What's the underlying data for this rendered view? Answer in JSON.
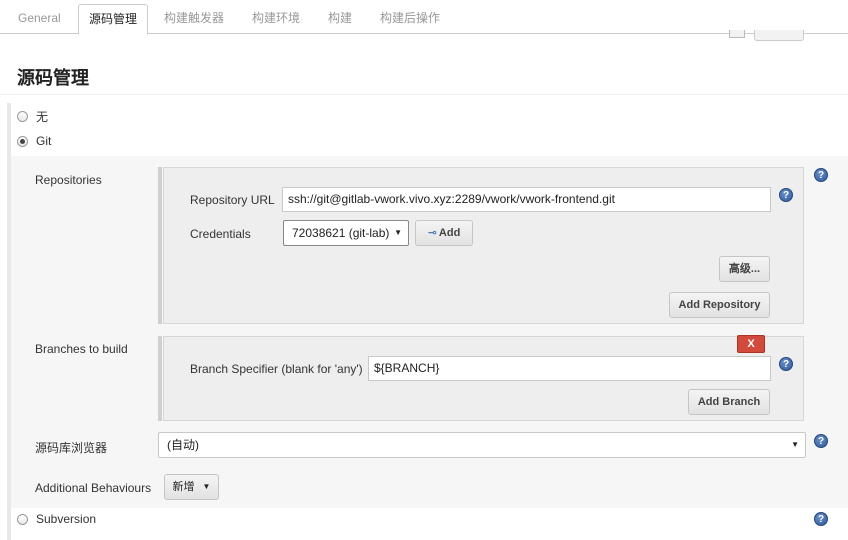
{
  "tabs": [
    {
      "label": "General",
      "active": false
    },
    {
      "label": "源码管理",
      "active": true
    },
    {
      "label": "构建触发器",
      "active": false
    },
    {
      "label": "构建环境",
      "active": false
    },
    {
      "label": "构建",
      "active": false
    },
    {
      "label": "构建后操作",
      "active": false
    }
  ],
  "section": {
    "title": "源码管理",
    "options": {
      "none": "无",
      "git": "Git",
      "subversion": "Subversion"
    },
    "selected": "Git"
  },
  "repositories": {
    "label": "Repositories",
    "url_label": "Repository URL",
    "url_value": "ssh://git@gitlab-vwork.vivo.xyz:2289/vwork/vwork-frontend.git",
    "credentials_label": "Credentials",
    "credentials_value": "72038621 (git-lab)",
    "add_label": "Add",
    "advanced_label": "高级...",
    "add_repository_label": "Add Repository"
  },
  "branches": {
    "label": "Branches to build",
    "delete_label": "X",
    "specifier_label": "Branch Specifier (blank for 'any')",
    "specifier_value": "${BRANCH}",
    "add_branch_label": "Add Branch"
  },
  "browser": {
    "label": "源码库浏览器",
    "value": "(自动)"
  },
  "behaviours": {
    "label": "Additional Behaviours",
    "add_label": "新增"
  },
  "help_glyph": "?",
  "colors": {
    "help": "#2d5a9c",
    "delete": "#d24a3c"
  }
}
